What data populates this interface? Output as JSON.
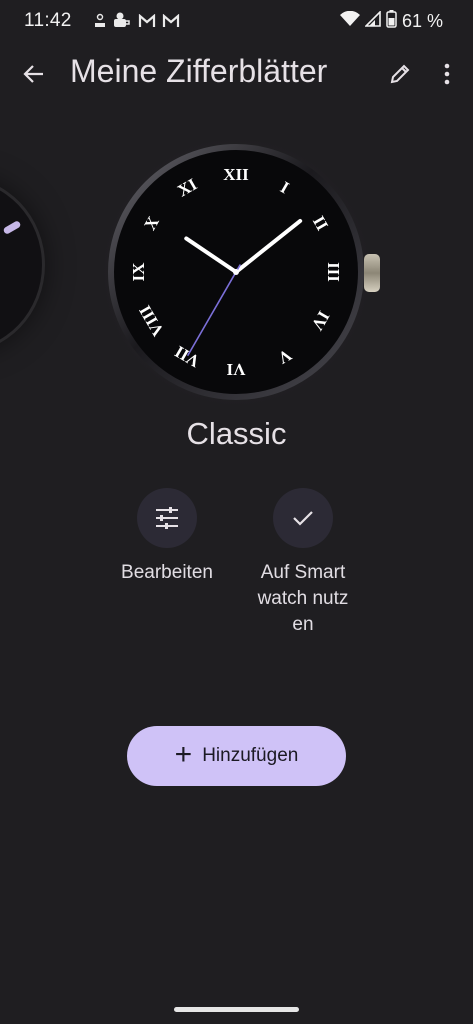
{
  "status_bar": {
    "time": "11:42",
    "notification_icons": [
      "person-badge-icon",
      "coffee-char-icon",
      "gmail-icon",
      "gmail-icon"
    ],
    "battery": "61 %"
  },
  "app_bar": {
    "title": "Meine Zifferblätter"
  },
  "watch_face": {
    "name": "Classic",
    "numerals": [
      "XII",
      "I",
      "II",
      "III",
      "IV",
      "V",
      "VI",
      "VII",
      "VIII",
      "IX",
      "X",
      "XI"
    ],
    "time_shown": "10:08:35"
  },
  "actions": {
    "edit_label": "Bearbeiten",
    "use_label": "Auf Smartwatch nutzen"
  },
  "add_button": {
    "label": "Hinzufügen"
  },
  "colors": {
    "background": "#1f1e21",
    "accent": "#cfc2f7",
    "action_circle": "#2c2a35",
    "second_hand": "#7b6fd8"
  }
}
